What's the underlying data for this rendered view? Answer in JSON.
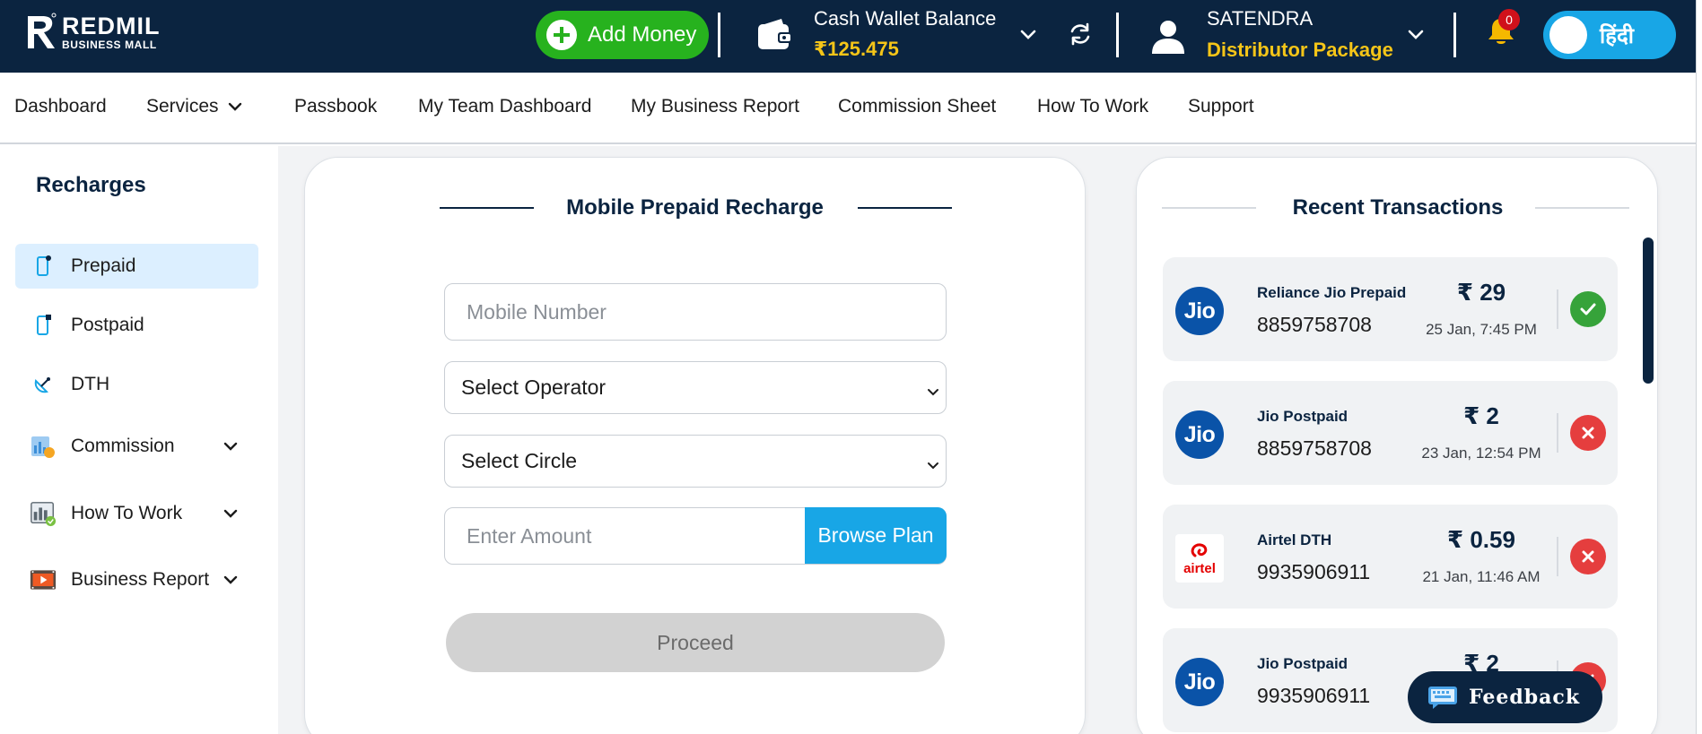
{
  "brand": {
    "name": "REDMIL",
    "subtitle": "BUSINESS MALL"
  },
  "header": {
    "add_money_label": "Add Money",
    "wallet_label": "Cash Wallet Balance",
    "wallet_amount": "₹125.475",
    "user_name": "SATENDRA",
    "user_package": "Distributor Package",
    "notification_count": "0",
    "language_label": "हिंदी"
  },
  "nav": {
    "items": [
      "Dashboard",
      "Services",
      "Passbook",
      "My Team Dashboard",
      "My Business Report",
      "Commission Sheet",
      "How To Work",
      "Support"
    ]
  },
  "sidebar": {
    "title": "Recharges",
    "items": [
      {
        "label": "Prepaid",
        "icon": "mobile-icon",
        "active": true
      },
      {
        "label": "Postpaid",
        "icon": "mobile-icon"
      },
      {
        "label": "DTH",
        "icon": "satellite-dish-icon"
      },
      {
        "label": "Commission",
        "icon": "commission-icon",
        "expandable": true
      },
      {
        "label": "How To Work",
        "icon": "how-to-work-icon",
        "expandable": true
      },
      {
        "label": "Business Report",
        "icon": "video-report-icon",
        "expandable": true
      }
    ]
  },
  "recharge_form": {
    "title": "Mobile Prepaid Recharge",
    "mobile_placeholder": "Mobile Number",
    "operator_value": "Select Operator",
    "circle_value": "Select Circle",
    "amount_placeholder": "Enter Amount",
    "browse_plan_label": "Browse Plan",
    "proceed_label": "Proceed"
  },
  "transactions": {
    "title": "Recent Transactions",
    "rows": [
      {
        "logo": "Jio",
        "operator": "Reliance Jio Prepaid",
        "number": "8859758708",
        "amount": "₹ 29",
        "date": "25 Jan, 7:45 PM",
        "status": "success"
      },
      {
        "logo": "Jio",
        "operator": "Jio Postpaid",
        "number": "8859758708",
        "amount": "₹ 2",
        "date": "23 Jan, 12:54 PM",
        "status": "failed"
      },
      {
        "logo": "airtel",
        "operator": "Airtel DTH",
        "number": "9935906911",
        "amount": "₹ 0.59",
        "date": "21 Jan, 11:46 AM",
        "status": "failed"
      },
      {
        "logo": "Jio",
        "operator": "Jio Postpaid",
        "number": "9935906911",
        "amount": "₹ 2",
        "date": "",
        "status": "failed"
      }
    ]
  },
  "feedback_label": "Feedback",
  "colors": {
    "navy": "#0b2440",
    "green": "#27b21e",
    "blue": "#18a6e6",
    "gold": "#f5c518",
    "red": "#e53e3e"
  }
}
